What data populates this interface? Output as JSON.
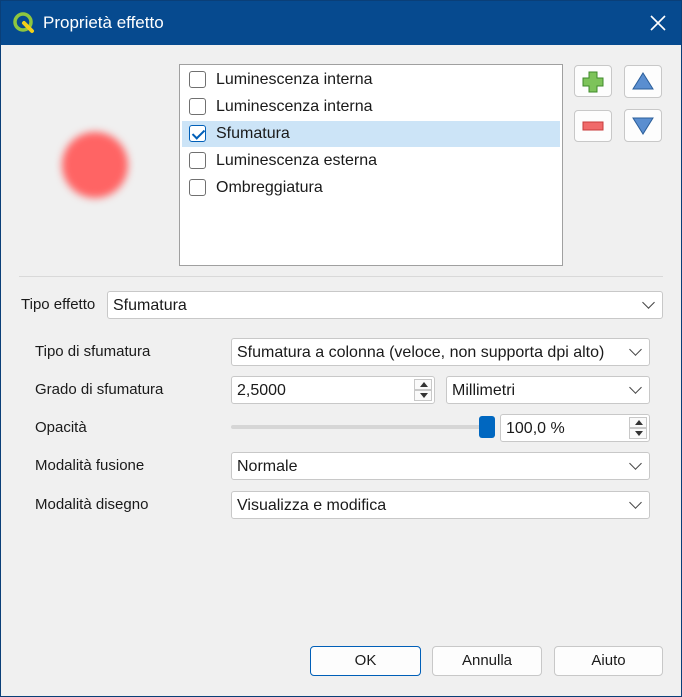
{
  "window": {
    "title": "Proprietà effetto"
  },
  "effects": [
    {
      "label": "Luminescenza interna",
      "checked": false,
      "selected": false
    },
    {
      "label": "Luminescenza interna",
      "checked": false,
      "selected": false
    },
    {
      "label": "Sfumatura",
      "checked": true,
      "selected": true
    },
    {
      "label": "Luminescenza esterna",
      "checked": false,
      "selected": false
    },
    {
      "label": "Ombreggiatura",
      "checked": false,
      "selected": false
    }
  ],
  "effect_type": {
    "label": "Tipo effetto",
    "value": "Sfumatura"
  },
  "blur_type": {
    "label": "Tipo di sfumatura",
    "value": "Sfumatura a colonna (veloce, non supporta dpi alto)"
  },
  "blur_strength": {
    "label": "Grado di sfumatura",
    "value": "2,5000",
    "unit": "Millimetri"
  },
  "opacity": {
    "label": "Opacità",
    "value": "100,0 %",
    "level": 1.0
  },
  "blend_mode": {
    "label": "Modalità fusione",
    "value": "Normale"
  },
  "draw_mode": {
    "label": "Modalità disegno",
    "value": "Visualizza e modifica"
  },
  "buttons": {
    "ok": "OK",
    "cancel": "Annulla",
    "help": "Aiuto"
  },
  "colors": {
    "titlebar": "#064a8f",
    "accent": "#0067c0",
    "preview": "#ff6464"
  }
}
